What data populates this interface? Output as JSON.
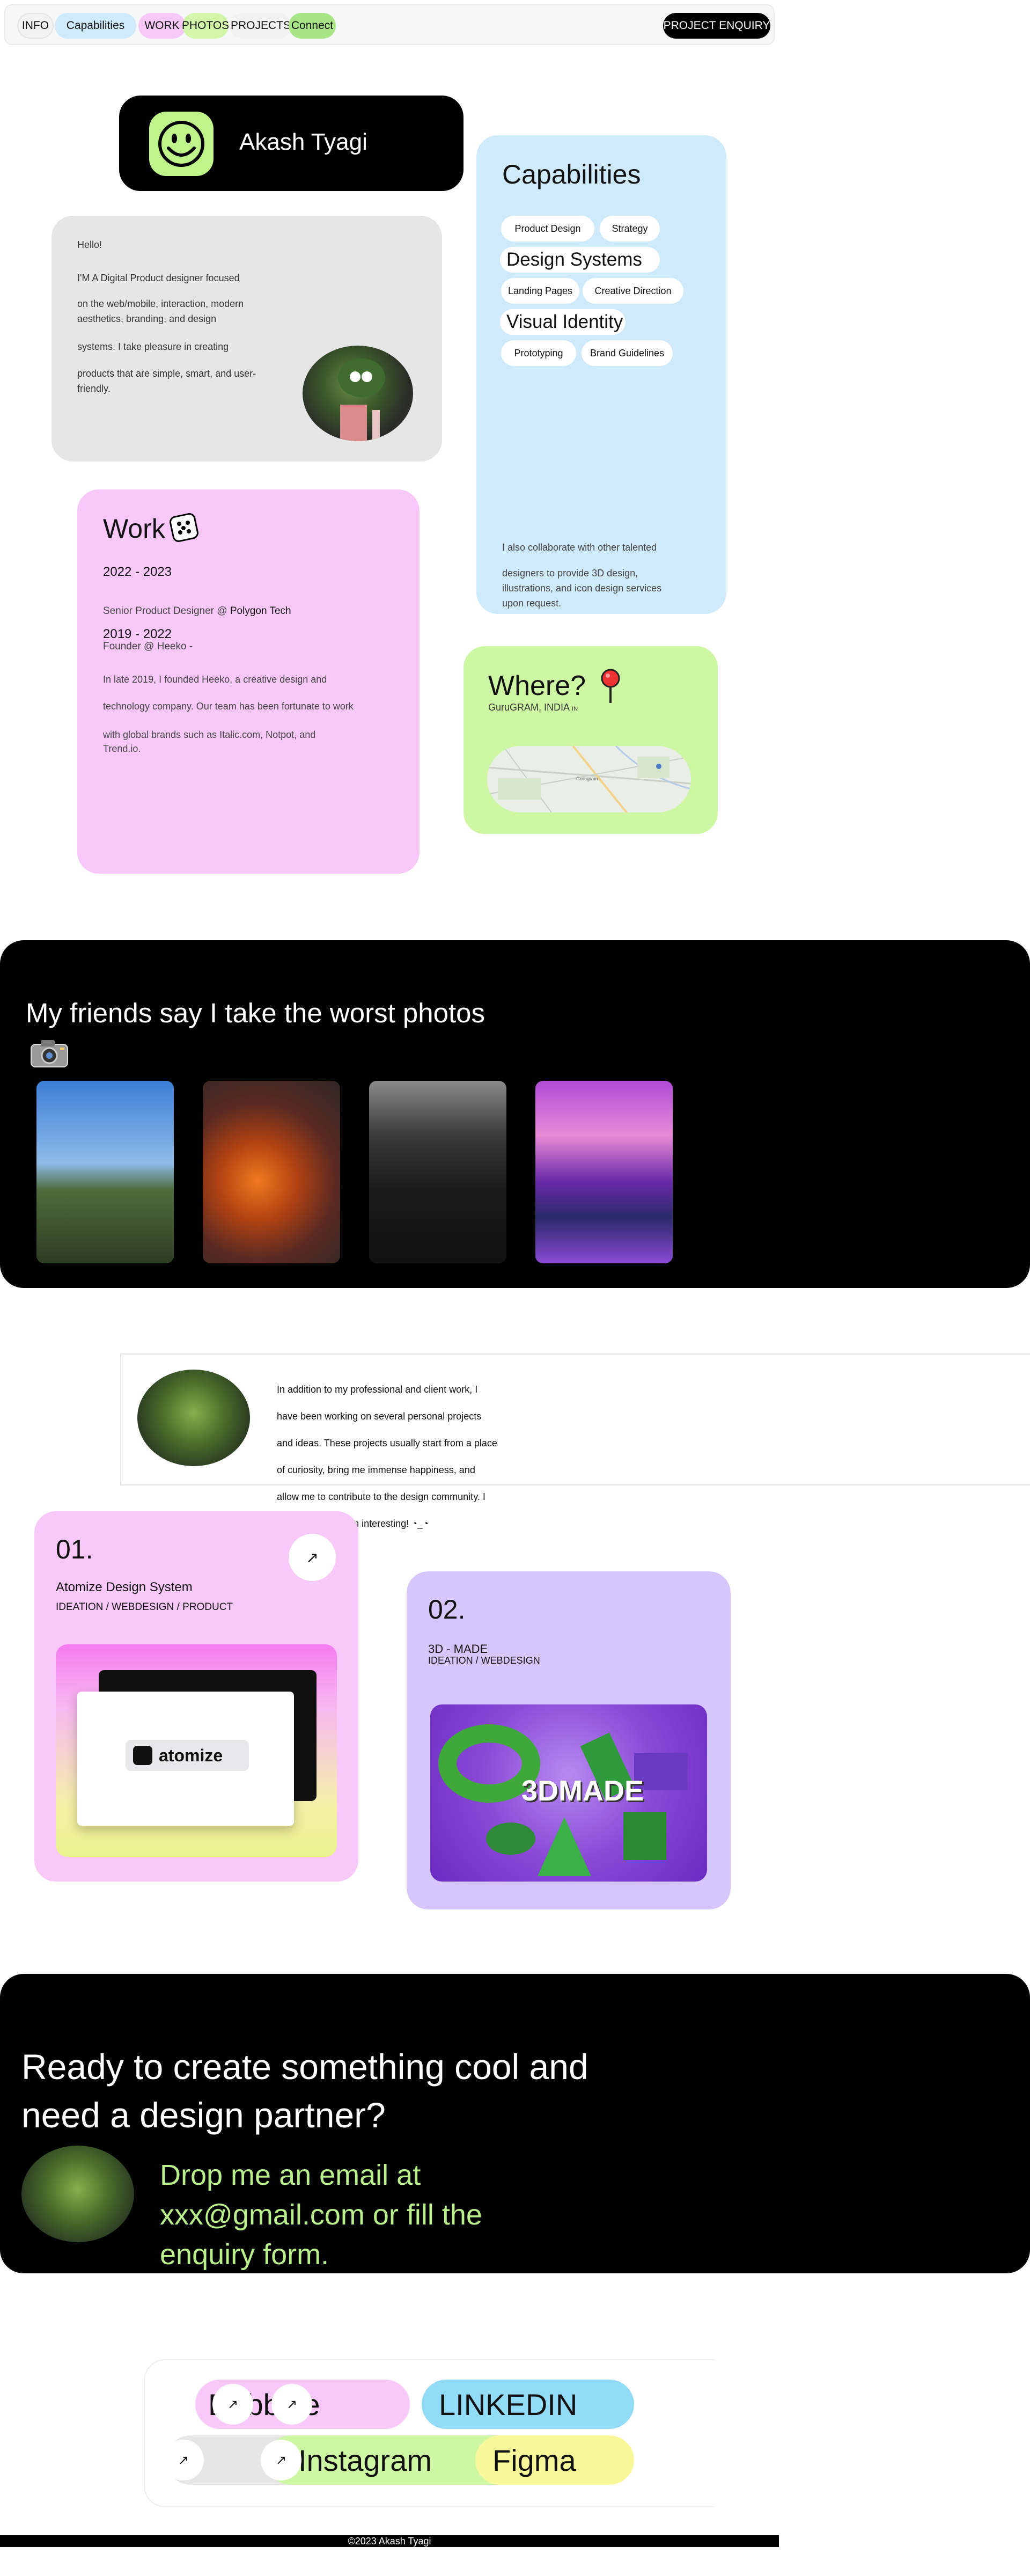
{
  "nav": {
    "info": "INFO",
    "capabilities": "Capabilities",
    "work": "WORK",
    "photos": "PHOTOS",
    "projects": "PROJECTS",
    "connect": "Connect",
    "enquiry": "PROJECT ENQUIRY"
  },
  "profile": {
    "name": "Akash Tyagi"
  },
  "hello": {
    "greeting": "Hello!",
    "line1": "I'M A Digital Product designer focused",
    "line2": "on the web/mobile, interaction, modern aesthetics, branding, and design",
    "line3": "systems. I take pleasure in creating",
    "line4": "products that are simple, smart, and user-friendly."
  },
  "capabilities": {
    "title": "Capabilities",
    "tags": [
      "Product Design",
      "Strategy",
      "Design Systems",
      "Landing Pages",
      "Creative Direction",
      "Visual Identity",
      "Prototyping",
      "Brand Guidelines"
    ],
    "note_line1": "I also collaborate with other talented",
    "note_line2": "designers to provide 3D design, illustrations, and icon design services upon request."
  },
  "work": {
    "title": "Work",
    "period1": "2022 - 2023",
    "role1": "Senior Product Designer @ ",
    "company1": "Polygon Tech",
    "period2": "2019 - 2022",
    "role2": "Founder @ Heeko -",
    "desc1": "In late 2019, I founded Heeko, a creative design and",
    "desc2": "technology company. Our team has been fortunate to work",
    "desc3": "with global brands such as Italic.com, Notpot, and Trend.io."
  },
  "where": {
    "title": "Where?",
    "location": "GuruGRAM, INDIA",
    "location_suffix": "IN",
    "map_label": "Gurugram"
  },
  "photos": {
    "title": "My friends say I take the worst photos"
  },
  "intro": {
    "text": "In addition to my professional and client work, I have been working on several personal projects and ideas. These projects usually start from a place of curiosity, bring me immense happiness, and allow me to contribute to the design community. I hope you find them interesting! ◔_◔"
  },
  "projects": [
    {
      "number": "01.",
      "title": "Atomize Design System",
      "tags": "IDEATION / WEBDESIGN / PRODUCT",
      "image_label": "atomize"
    },
    {
      "number": "02.",
      "title": "3D - MADE",
      "tags": "IDEATION / WEBDESIGN",
      "image_label": "3DMADE"
    }
  ],
  "cta": {
    "title": "Ready to create something cool and need a design partner?",
    "text": "Drop me an email at xxx@gmail.com or fill the enquiry form."
  },
  "social": {
    "dribbble": "Dribbble",
    "linkedin": "LINKEDIN",
    "instagram": "Instagram",
    "figma": "Figma"
  },
  "footer": {
    "copyright": "©2023 Akash Tyagi"
  },
  "colors": {
    "pink": "#f8c8f8",
    "blue": "#cfeafb",
    "green": "#cdf7a2",
    "lavender": "#d6c6fb",
    "cta_green": "#b9f08c"
  },
  "icons": [
    "smiley-icon",
    "dice-icon",
    "pin-icon",
    "camera-icon",
    "arrow-up-right-icon"
  ]
}
